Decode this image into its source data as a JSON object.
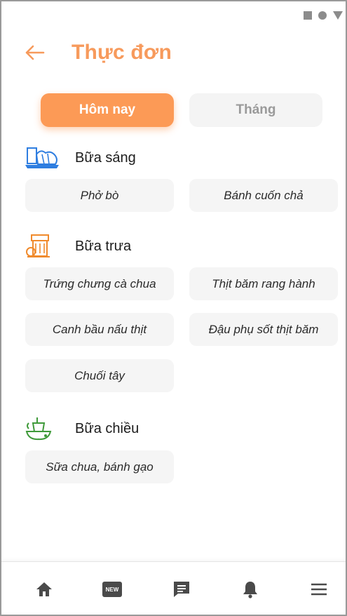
{
  "header": {
    "title": "Thực đơn",
    "back_icon": "arrow-left-icon"
  },
  "tabs": [
    {
      "label": "Hôm nay",
      "active": true
    },
    {
      "label": "Tháng",
      "active": false
    }
  ],
  "colors": {
    "accent": "#fc9a56",
    "breakfast_icon": "#2f7ee0",
    "lunch_icon": "#f08a2c",
    "afternoon_icon": "#3f9a3a",
    "nav_icon": "#4a4a4a"
  },
  "sections": {
    "breakfast": {
      "title": "Bữa sáng",
      "icon": "breakfast-icon",
      "items": [
        "Phở bò",
        "Bánh cuốn chả"
      ]
    },
    "lunch": {
      "title": "Bữa trưa",
      "icon": "lunch-icon",
      "items": [
        "Trứng chưng cà chua",
        "Thịt băm rang hành",
        "Canh bầu nấu thịt",
        "Đậu phụ sốt thịt băm",
        "Chuối tây"
      ]
    },
    "afternoon": {
      "title": "Bữa chiều",
      "icon": "afternoon-snack-icon",
      "items": [
        "Sữa chua, bánh gạo"
      ]
    }
  },
  "bottom_nav": {
    "items": [
      "home-icon",
      "news-icon",
      "message-icon",
      "bell-icon",
      "menu-icon"
    ],
    "news_badge": "NEW"
  }
}
